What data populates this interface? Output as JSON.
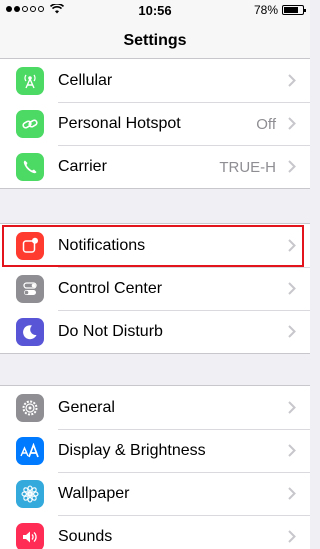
{
  "status_bar": {
    "time": "10:56",
    "battery_text": "78%",
    "battery_level": 0.78,
    "signal_bars_filled": 2,
    "signal_bars_total": 5
  },
  "nav": {
    "title": "Settings"
  },
  "group1": [
    {
      "label": "Cellular",
      "value": "",
      "icon": "cellular-antenna-icon",
      "color": "#4cd964"
    },
    {
      "label": "Personal Hotspot",
      "value": "Off",
      "icon": "hotspot-chain-icon",
      "color": "#4cd964"
    },
    {
      "label": "Carrier",
      "value": "TRUE-H",
      "icon": "phone-icon",
      "color": "#4cd964"
    }
  ],
  "group2": [
    {
      "label": "Notifications",
      "value": "",
      "icon": "notifications-icon",
      "color": "#ff3b30"
    },
    {
      "label": "Control Center",
      "value": "",
      "icon": "control-center-toggles-icon",
      "color": "#8e8e93"
    },
    {
      "label": "Do Not Disturb",
      "value": "",
      "icon": "moon-icon",
      "color": "#5856d6"
    }
  ],
  "group3": [
    {
      "label": "General",
      "value": "",
      "icon": "gear-icon",
      "color": "#8e8e93"
    },
    {
      "label": "Display & Brightness",
      "value": "",
      "icon": "text-size-aa-icon",
      "color": "#007aff"
    },
    {
      "label": "Wallpaper",
      "value": "",
      "icon": "wallpaper-flower-icon",
      "color": "#34aadc"
    },
    {
      "label": "Sounds",
      "value": "",
      "icon": "speaker-icon",
      "color": "#ff2d55"
    }
  ],
  "highlight_color": "#e3141c"
}
